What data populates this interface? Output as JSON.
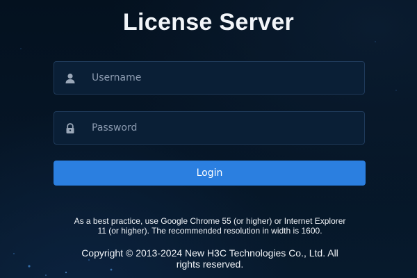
{
  "page": {
    "title": "License Server"
  },
  "login_form": {
    "username": {
      "value": "",
      "placeholder": "Username",
      "icon": "user-icon"
    },
    "password": {
      "value": "",
      "placeholder": "Password",
      "icon": "lock-icon"
    },
    "login_label": "Login"
  },
  "footer": {
    "browser_notice": "As a best practice, use Google Chrome 55 (or higher) or Internet Explorer 11 (or higher). The recommended resolution in width is 1600.",
    "copyright": "Copyright © 2013-2024 New H3C Technologies Co., Ltd. All rights reserved."
  },
  "colors": {
    "background": "#061627",
    "field_background": "#0a1f36",
    "field_border": "#1f3a5a",
    "accent": "#2b7fe0",
    "icon": "#9aa7b8"
  }
}
